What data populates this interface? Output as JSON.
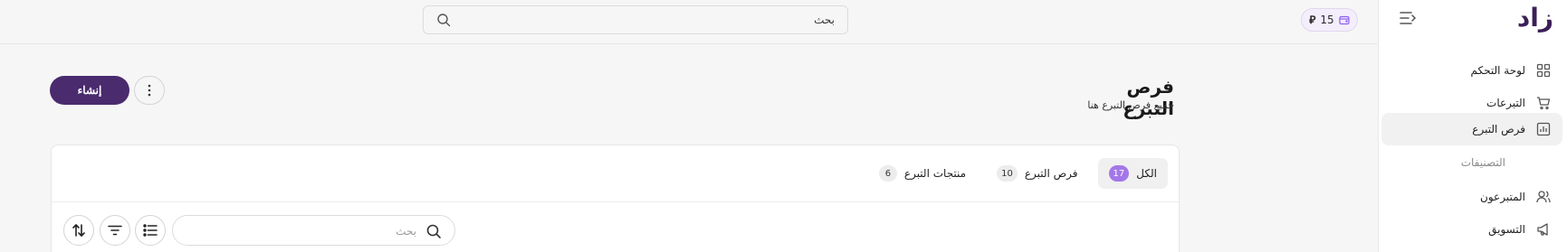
{
  "sidebar": {
    "logo": "زاد",
    "items": [
      {
        "label": "لوحة التحكم",
        "icon": "dashboard-icon"
      },
      {
        "label": "التبرعات",
        "icon": "cart-icon"
      },
      {
        "label": "فرص التبرع",
        "icon": "chart-bars-icon",
        "active": true
      },
      {
        "label": "التصنيفات",
        "sub": true
      },
      {
        "label": "المتبرعون",
        "icon": "users-icon"
      },
      {
        "label": "التسويق",
        "icon": "megaphone-icon"
      }
    ]
  },
  "topbar": {
    "balance": "15",
    "currency_symbol": "⃁",
    "search_placeholder": "بحث"
  },
  "page": {
    "title": "فرص التبرع",
    "subtitle": "جميع فرص التبرع هنا",
    "create_label": "إنشاء"
  },
  "tabs": [
    {
      "label": "الكل",
      "count": "17",
      "active": true
    },
    {
      "label": "فرص التبرع",
      "count": "10"
    },
    {
      "label": "منتجات التبرع",
      "count": "6"
    }
  ],
  "filters": {
    "search_placeholder": "بحث"
  },
  "colors": {
    "primary": "#4a2b6e",
    "accent": "#a477e8"
  }
}
